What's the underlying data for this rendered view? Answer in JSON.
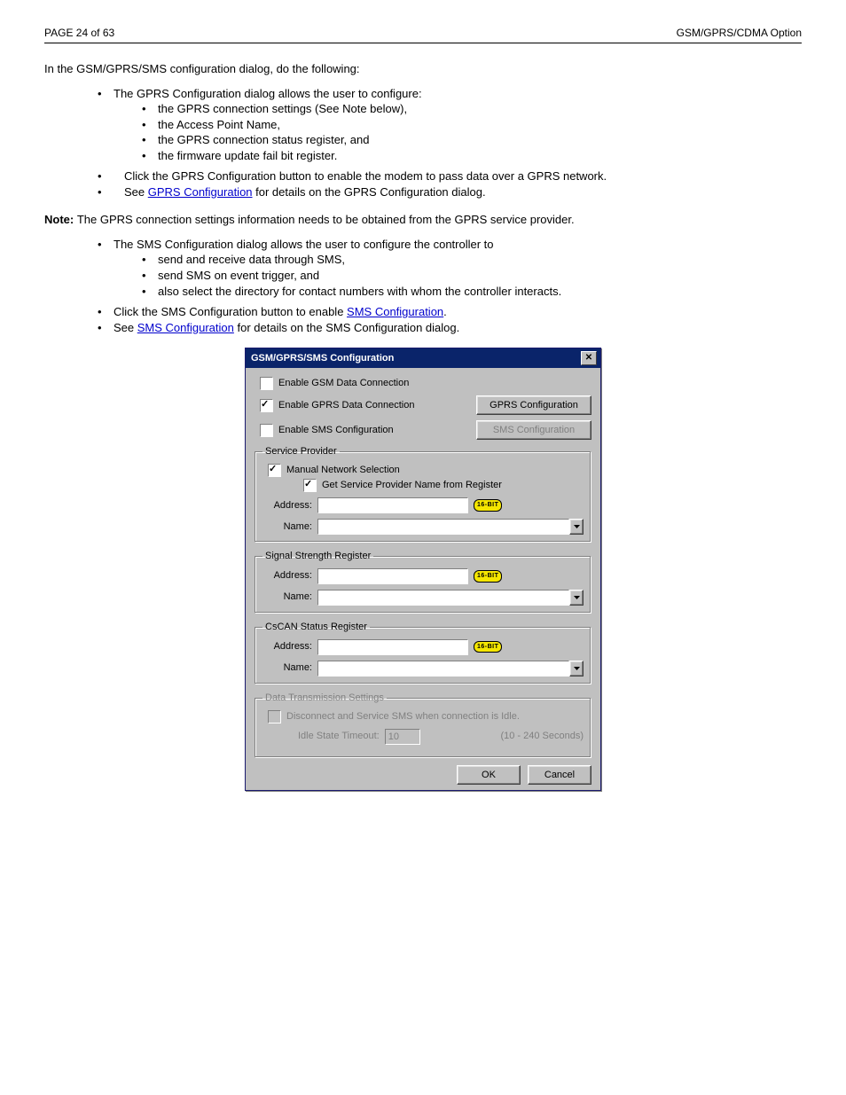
{
  "header": {
    "left": "PAGE 24 of 63",
    "right": "GSM/GPRS/CDMA Option"
  },
  "top_rule_present": true,
  "body": {
    "intro": "In the GSM/GPRS/SMS configuration dialog, do the following:",
    "gprs_bullets": {
      "main": "The GPRS Configuration dialog allows the user to configure:",
      "sub": [
        "the GPRS connection settings (See Note below),",
        "the Access Point Name,",
        "the GPRS connection status register, and",
        "the firmware update fail bit register."
      ],
      "click_config": "Click the GPRS Configuration button to enable the modem to pass data over a GPRS network.",
      "see_link": {
        "before": "See ",
        "link": "GPRS Configuration",
        "after": " for details on the GPRS Configuration dialog."
      }
    },
    "note_label": "Note: ",
    "note_text": "The GPRS connection settings information needs to be obtained from the GPRS service provider.",
    "sms_bullets": {
      "main": "The  SMS  Configuration  dialog  allows  the  user  to  configure  the  controller  to",
      "sub": [
        "send and receive data through SMS,",
        "send SMS on event trigger, and",
        "also  select  the  directory  for  contact  numbers  with  whom  the  controller interacts."
      ],
      "click_config": {
        "before": "Click the SMS Configuration button to enable ",
        "link": "SMS Configuration",
        "after": "."
      },
      "see_link": {
        "before": "See ",
        "link": "SMS Configuration",
        "after": " for details on the SMS Configuration dialog."
      }
    }
  },
  "dialog": {
    "title": "GSM/GPRS/SMS Configuration",
    "enable_gsm": {
      "label": "Enable GSM Data Connection",
      "checked": false
    },
    "enable_gprs": {
      "label": "Enable GPRS Data Connection",
      "checked": true
    },
    "gprs_button": "GPRS Configuration",
    "enable_sms": {
      "label": "Enable SMS Configuration",
      "checked": false
    },
    "sms_button": "SMS Configuration",
    "service_provider": {
      "legend": "Service Provider",
      "manual": {
        "label": "Manual Network Selection",
        "checked": true
      },
      "get_name": {
        "label": "Get Service Provider Name from Register",
        "checked": true
      },
      "address_label": "Address:",
      "name_label": "Name:",
      "badge": "16-BIT"
    },
    "signal": {
      "legend": "Signal Strength Register",
      "address_label": "Address:",
      "name_label": "Name:",
      "badge": "16-BIT"
    },
    "cscan": {
      "legend": "CsCAN Status Register",
      "address_label": "Address:",
      "name_label": "Name:",
      "badge": "16-BIT"
    },
    "data_trans": {
      "legend": "Data Transmission Settings",
      "disconnect_label": "Disconnect and Service SMS when  connection is Idle.",
      "idle_label": "Idle State Timeout:",
      "idle_value": "10",
      "idle_hint": "(10 - 240 Seconds)"
    },
    "ok": "OK",
    "cancel": "Cancel"
  }
}
